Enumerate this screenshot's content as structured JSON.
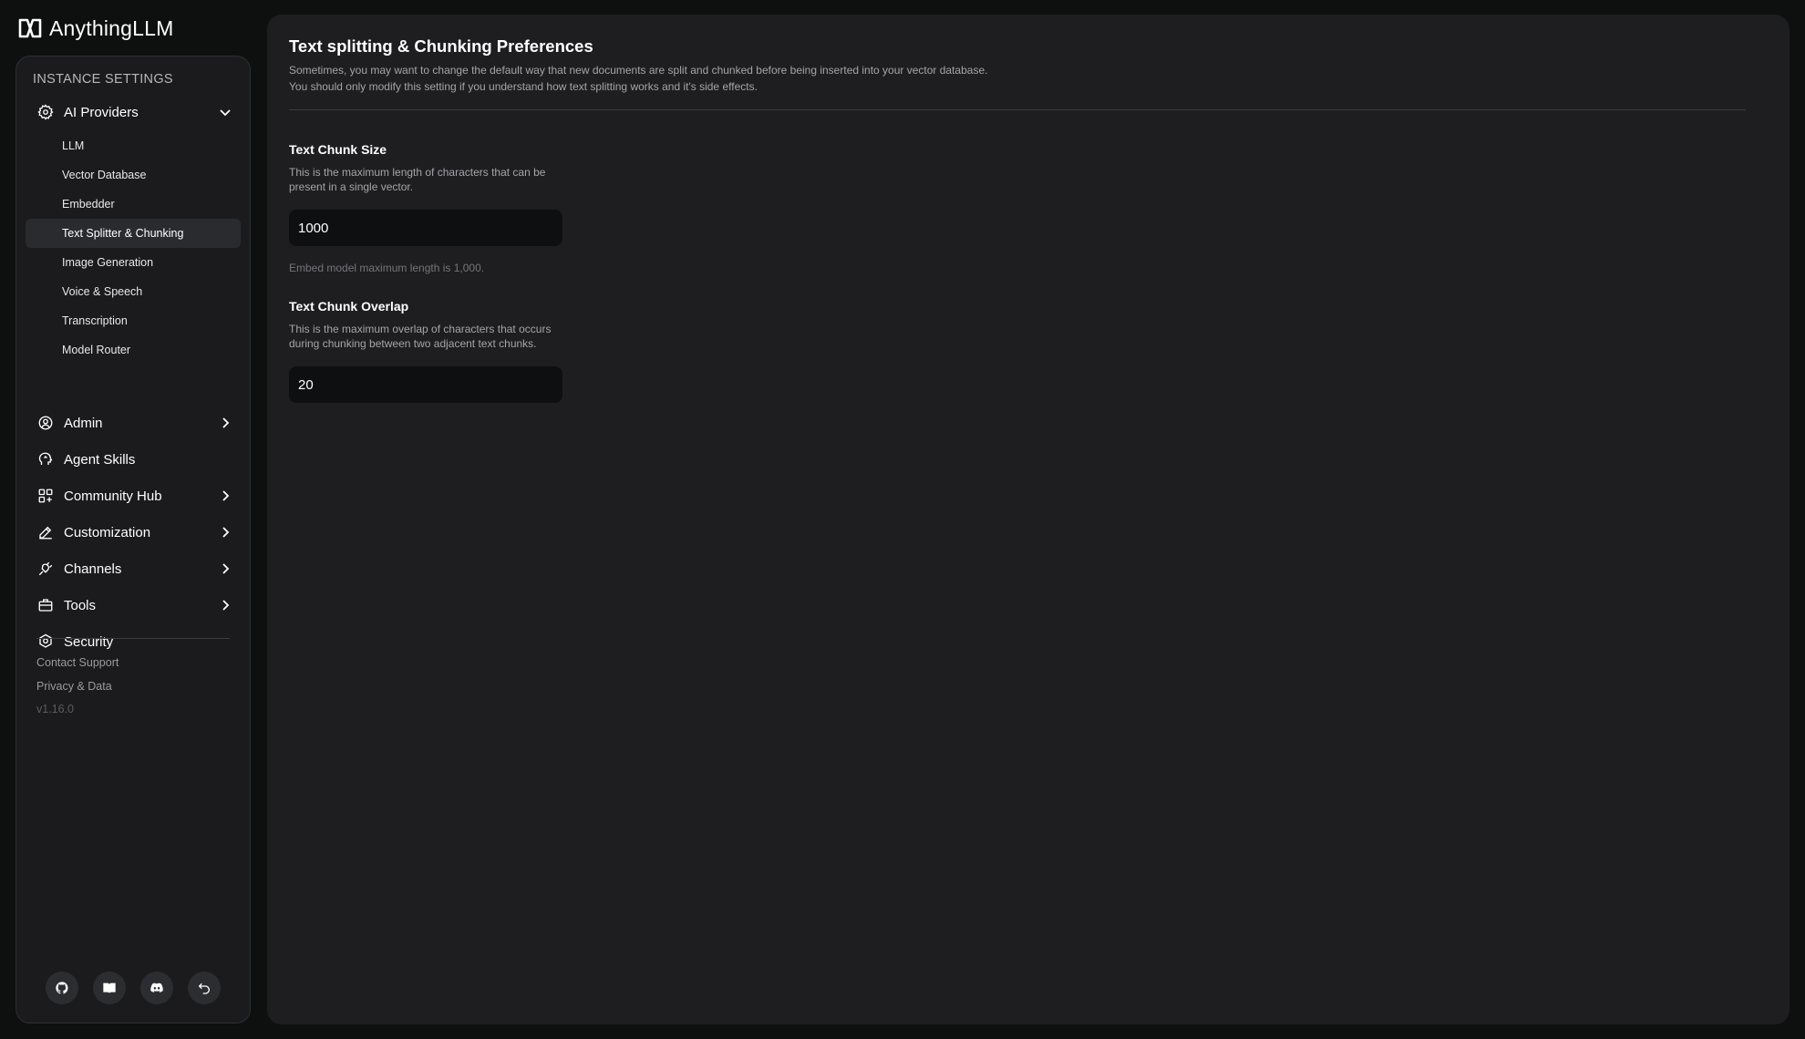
{
  "app": {
    "name": "AnythingLLM"
  },
  "sidebar": {
    "heading": "INSTANCE SETTINGS",
    "ai_providers": {
      "label": "AI Providers",
      "icon": "gear-icon",
      "expanded": true,
      "items": [
        {
          "label": "LLM",
          "active": false
        },
        {
          "label": "Vector Database",
          "active": false
        },
        {
          "label": "Embedder",
          "active": false
        },
        {
          "label": "Text Splitter & Chunking",
          "active": true
        },
        {
          "label": "Image Generation",
          "active": false
        },
        {
          "label": "Voice & Speech",
          "active": false
        },
        {
          "label": "Transcription",
          "active": false
        },
        {
          "label": "Model Router",
          "active": false
        }
      ]
    },
    "nav": [
      {
        "label": "Admin",
        "icon": "admin-gear-icon",
        "has_children": true
      },
      {
        "label": "Agent Skills",
        "icon": "agent-head-icon",
        "has_children": false
      },
      {
        "label": "Community Hub",
        "icon": "grid-icon",
        "has_children": true
      },
      {
        "label": "Customization",
        "icon": "pencil-icon",
        "has_children": true
      },
      {
        "label": "Channels",
        "icon": "plug-icon",
        "has_children": true
      },
      {
        "label": "Tools",
        "icon": "toolbox-icon",
        "has_children": true
      },
      {
        "label": "Security",
        "icon": "shield-icon",
        "has_children": false
      }
    ],
    "footer": {
      "contact_support": "Contact Support",
      "privacy_data": "Privacy & Data",
      "version": "v1.16.0"
    },
    "bottom_buttons": [
      "github-icon",
      "book-icon",
      "discord-icon",
      "undo-icon"
    ]
  },
  "main": {
    "title": "Text splitting & Chunking Preferences",
    "description_line1": "Sometimes, you may want to change the default way that new documents are split and chunked before being inserted into your vector database.",
    "description_line2": "You should only modify this setting if you understand how text splitting works and it's side effects.",
    "chunk_size": {
      "title": "Text Chunk Size",
      "description": "This is the maximum length of characters that can be present in a single vector.",
      "value": "1000",
      "hint": "Embed model maximum length is 1,000."
    },
    "chunk_overlap": {
      "title": "Text Chunk Overlap",
      "description": "This is the maximum overlap of characters that occurs during chunking between two adjacent text chunks.",
      "value": "20"
    }
  },
  "colors": {
    "background": "#0e0f0f",
    "sidebar": "#1b1b1e",
    "panel": "#1e1e21",
    "input": "#0e0f10",
    "active_item": "#2a2b2f"
  }
}
